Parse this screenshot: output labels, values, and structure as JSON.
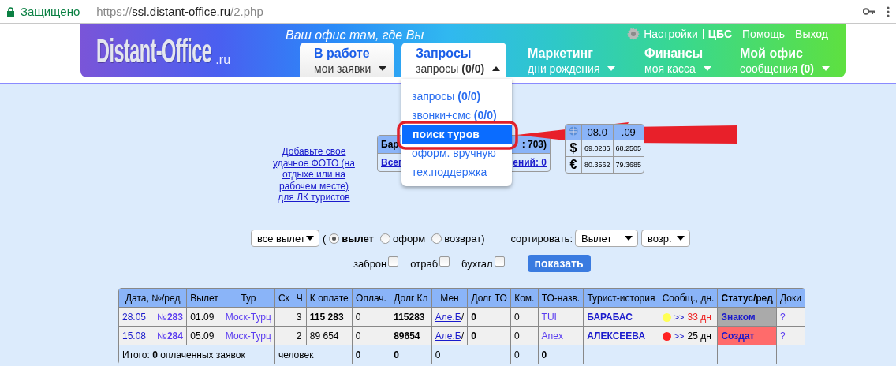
{
  "browser": {
    "security": "Защищено",
    "url_scheme": "https://",
    "url_host": "ssl.distant-office.ru",
    "url_path": "/2.php"
  },
  "header": {
    "logo": "Distant-Office",
    "logo_suffix": ".ru",
    "tagline": "Ваш офис там, где Вы",
    "links": [
      {
        "label": "Настройки",
        "bold": false
      },
      {
        "label": "ЦБС",
        "bold": true
      },
      {
        "label": "Помощь",
        "bold": false
      },
      {
        "label": "Выход",
        "bold": false
      }
    ],
    "tabs": [
      {
        "title": "В работе",
        "subtitle": "мои заявки",
        "selected": true,
        "expanded": false
      },
      {
        "title": "Запросы",
        "subtitle": "запросы **(0/0)**",
        "selected": false,
        "expanded": true,
        "items": [
          {
            "label": "запросы **(0/0)**",
            "selected": false
          },
          {
            "label": "звонки+смс **(0/0)**",
            "selected": false
          },
          {
            "label": "поиск туров",
            "selected": true
          },
          {
            "label": "оформ. вручную",
            "selected": false
          },
          {
            "label": "тех.поддержка",
            "selected": false
          }
        ]
      },
      {
        "title": "Маркетинг",
        "subtitle": "дни рождения",
        "selected": false,
        "expanded": false
      },
      {
        "title": "Финансы",
        "subtitle": "моя касса",
        "selected": false,
        "expanded": false
      },
      {
        "title": "Мой офис",
        "subtitle": "сообщения **(0)**",
        "selected": false,
        "expanded": false
      }
    ]
  },
  "photo_link": "Добавьте свое удачное ФОТО (на отдыхе или на рабочем месте) для ЛК туристов",
  "summary_panel": {
    "header_left": "Бар",
    "header_right": ": 703)",
    "link_left": "Всег",
    "link_right": "ений: 0"
  },
  "rates": {
    "columns": [
      "08.0",
      ".09"
    ],
    "rows": [
      {
        "currency": "$",
        "values": [
          "69.0286",
          "68.2505"
        ]
      },
      {
        "currency": "€",
        "values": [
          "80.3562",
          "79.3685"
        ]
      }
    ]
  },
  "filters": {
    "period_select": "все вылет",
    "open_paren": "(",
    "radios": [
      {
        "label": "вылет",
        "selected": true
      },
      {
        "label": "оформ",
        "selected": false
      },
      {
        "label": "возврат",
        "selected": false
      }
    ],
    "close_paren": ")",
    "sort_label": "сортировать:",
    "sort_selects": [
      "Вылет",
      "возр."
    ],
    "checkboxes": [
      {
        "label": "заброн",
        "checked": false
      },
      {
        "label": "отраб",
        "checked": false
      },
      {
        "label": "бухгал",
        "checked": false
      }
    ],
    "button": "показать"
  },
  "table": {
    "columns": [
      "Дата, №/ред",
      "Вылет",
      "Тур",
      "Ск",
      "Ч",
      "К оплате",
      "Оплач.",
      "Долг Кл",
      "Мен",
      "Долг ТО",
      "Ком.",
      "ТО-назв.",
      "Турист-история",
      "Сообщ., дн.",
      "Статус/ред",
      "Доки"
    ],
    "rows": [
      {
        "date": "28.05",
        "number": "№**283**",
        "departure": "01.09",
        "tour": "Моск-Турц",
        "people": "3",
        "to_pay": "115 283",
        "to_pay_bold": true,
        "paid": "0",
        "client_debt": "115283",
        "manager": "Але.Б",
        "manager_suffix": "/",
        "operator_debt": "0",
        "commission": "0",
        "operator": "TUI",
        "tourist": "БАРАБАС",
        "message": {
          "color": "#ffff55",
          "arrow": ">>",
          "days": "33 дн",
          "overdue": true
        },
        "status": {
          "label": "Знаком",
          "color": "#aaaaaa"
        },
        "docs": "?"
      },
      {
        "date": "15.08",
        "number": "№**284**",
        "departure": "05.09",
        "tour": "Моск-Турц",
        "people": "2",
        "to_pay": "89 654",
        "to_pay_bold": false,
        "paid": "0",
        "client_debt": "89654",
        "manager": "Але.Б",
        "manager_suffix": "/",
        "operator_debt": "0",
        "commission": "0",
        "operator": "Anex",
        "tourist": "АЛЕКСЕЕВА",
        "message": {
          "color": "#ff2222",
          "arrow": ">>",
          "days": "25 дн",
          "overdue": false
        },
        "status": {
          "label": "Создат",
          "color": "#ff6b6b"
        },
        "docs": "?"
      }
    ],
    "totals": {
      "label": "Итого: **0** оплаченных заявок",
      "people": "человек",
      "cells": [
        {
          "text": "0",
          "bold": true
        },
        {
          "text": "0",
          "bold": true
        },
        {
          "text": "0",
          "bold": false
        },
        {
          "text": "0",
          "bold": false
        },
        {
          "text": "0",
          "bold": true
        }
      ]
    }
  }
}
